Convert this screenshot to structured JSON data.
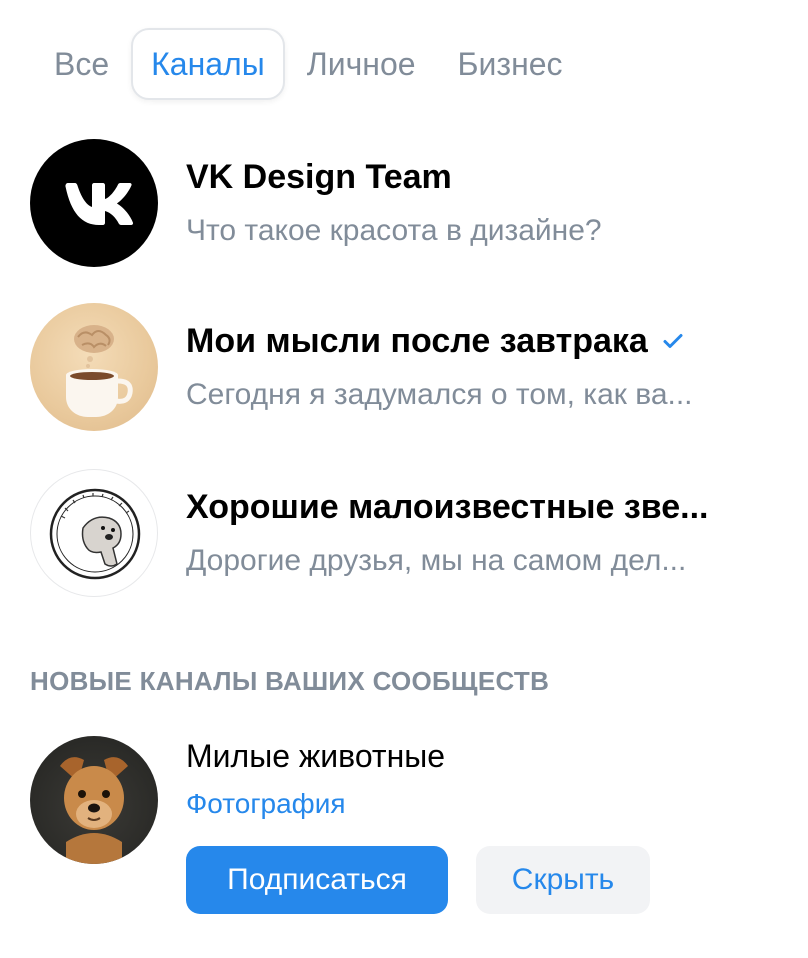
{
  "tabs": [
    {
      "label": "Все",
      "active": false
    },
    {
      "label": "Каналы",
      "active": true
    },
    {
      "label": "Личное",
      "active": false
    },
    {
      "label": "Бизнес",
      "active": false
    }
  ],
  "channels": [
    {
      "title": "VK Design Team",
      "subtitle": "Что такое красота в дизайне?",
      "verified": false,
      "avatar": "vk-logo"
    },
    {
      "title": "Мои мысли после завтрака",
      "subtitle": "Сегодня я задумался о том, как ва...",
      "verified": true,
      "avatar": "coffee-brain"
    },
    {
      "title": "Хорошие малоизвестные зве...",
      "subtitle": "Дорогие друзья, мы на самом дел...",
      "verified": false,
      "avatar": "animal-stamp"
    }
  ],
  "section": {
    "title": "НОВЫЕ КАНАЛЫ ВАШИХ СООБЩЕСТВ"
  },
  "suggestion": {
    "name": "Милые животные",
    "category": "Фотография",
    "subscribe_label": "Подписаться",
    "hide_label": "Скрыть",
    "avatar": "dog-photo"
  },
  "colors": {
    "accent": "#2688eb",
    "secondary_text": "#818c99",
    "secondary_button_bg": "#f2f3f5"
  }
}
